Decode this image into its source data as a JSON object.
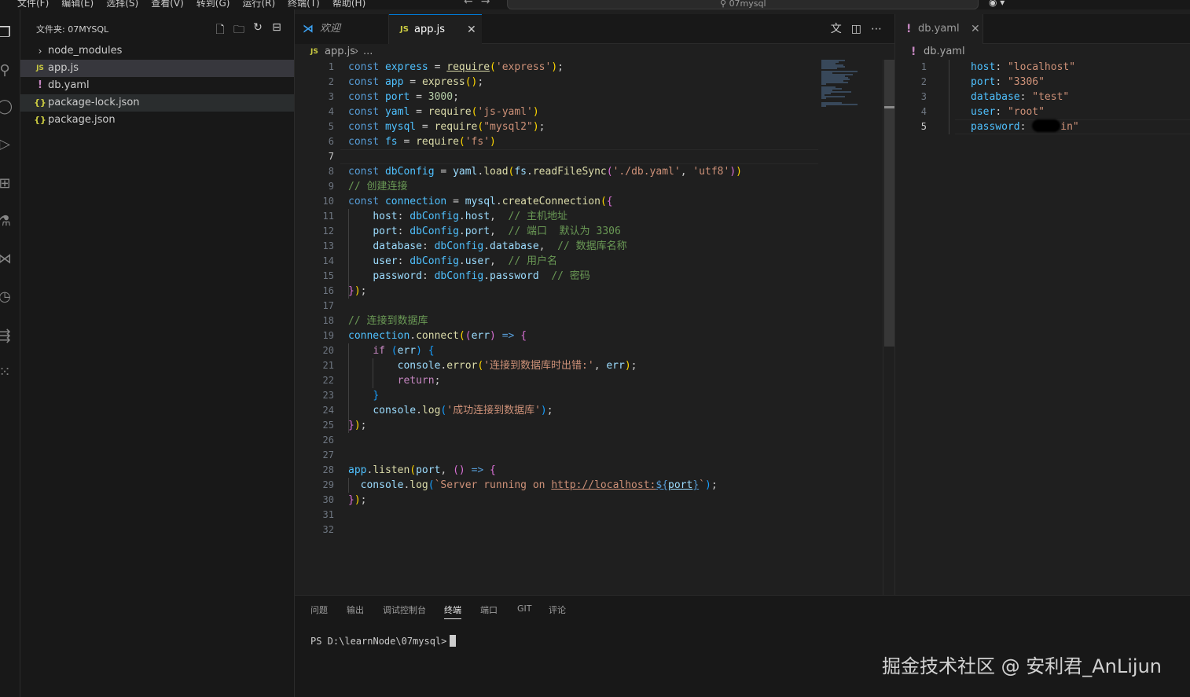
{
  "menu": [
    "文件(F)",
    "编辑(E)",
    "选择(S)",
    "查看(V)",
    "转到(G)",
    "运行(R)",
    "终端(T)",
    "帮助(H)"
  ],
  "command_center": {
    "text": "07mysql",
    "icon": "search-icon"
  },
  "explorer": {
    "title": "文件夹: 07MYSQL",
    "items": [
      {
        "label": "node_modules",
        "icon": "chevron-right-icon"
      },
      {
        "label": "app.js",
        "icon": "js-file-icon"
      },
      {
        "label": "db.yaml",
        "icon": "yaml-file-icon"
      },
      {
        "label": "package-lock.json",
        "icon": "json-file-icon"
      },
      {
        "label": "package.json",
        "icon": "json-file-icon"
      }
    ]
  },
  "tabs_left": [
    {
      "label": "欢迎",
      "icon": "vscode-icon"
    },
    {
      "label": "app.js",
      "icon": "js-file-icon"
    }
  ],
  "breadcrumb_left": {
    "file": "app.js",
    "rest": "..."
  },
  "tabs_right": [
    {
      "label": "db.yaml",
      "icon": "yaml-file-icon"
    }
  ],
  "breadcrumb_right": {
    "file": "db.yaml"
  },
  "code_app_js": {
    "current_line": 7,
    "line_numbers": [
      "1",
      "2",
      "3",
      "4",
      "5",
      "6",
      "7",
      "8",
      "9",
      "10",
      "11",
      "12",
      "13",
      "14",
      "15",
      "16",
      "17",
      "18",
      "19",
      "20",
      "21",
      "22",
      "23",
      "24",
      "25",
      "26",
      "27",
      "28",
      "29",
      "30",
      "31",
      "32"
    ],
    "comments": {
      "create_connection": "// 创建连接",
      "host": "// 主机地址",
      "port": "// 端口  默认为 3306",
      "database": "// 数据库名称",
      "user": "// 用户名",
      "password": "// 密码",
      "connect": "// 连接到数据库"
    },
    "strings": {
      "express": "'express'",
      "js_yaml": "'js-yaml'",
      "mysql2": "\"mysql2\"",
      "fs": "'fs'",
      "db_path": "'./db.yaml'",
      "utf8": "'utf8'",
      "error_msg": "'连接到数据库时出错:'",
      "success_msg": "'成功连接到数据库'",
      "server_msg": "Server running on ",
      "url": "http://localhost:",
      "port_num": "3000"
    }
  },
  "code_db_yaml": {
    "current_line": 5,
    "line_numbers": [
      "1",
      "2",
      "3",
      "4",
      "5"
    ],
    "lines": [
      {
        "key": "host",
        "value": "\"localhost\""
      },
      {
        "key": "port",
        "value": "\"3306\""
      },
      {
        "key": "database",
        "value": "\"test\""
      },
      {
        "key": "user",
        "value": "\"root\""
      },
      {
        "key": "password",
        "value": "in\""
      }
    ]
  },
  "panel": {
    "tabs": [
      "问题",
      "输出",
      "调试控制台",
      "终端",
      "端口",
      "GIT",
      "评论"
    ],
    "active_tab": "终端",
    "terminal_prompt": "PS D:\\learnNode\\07mysql>"
  },
  "watermark": "掘金技术社区 @ 安利君_AnLijun"
}
